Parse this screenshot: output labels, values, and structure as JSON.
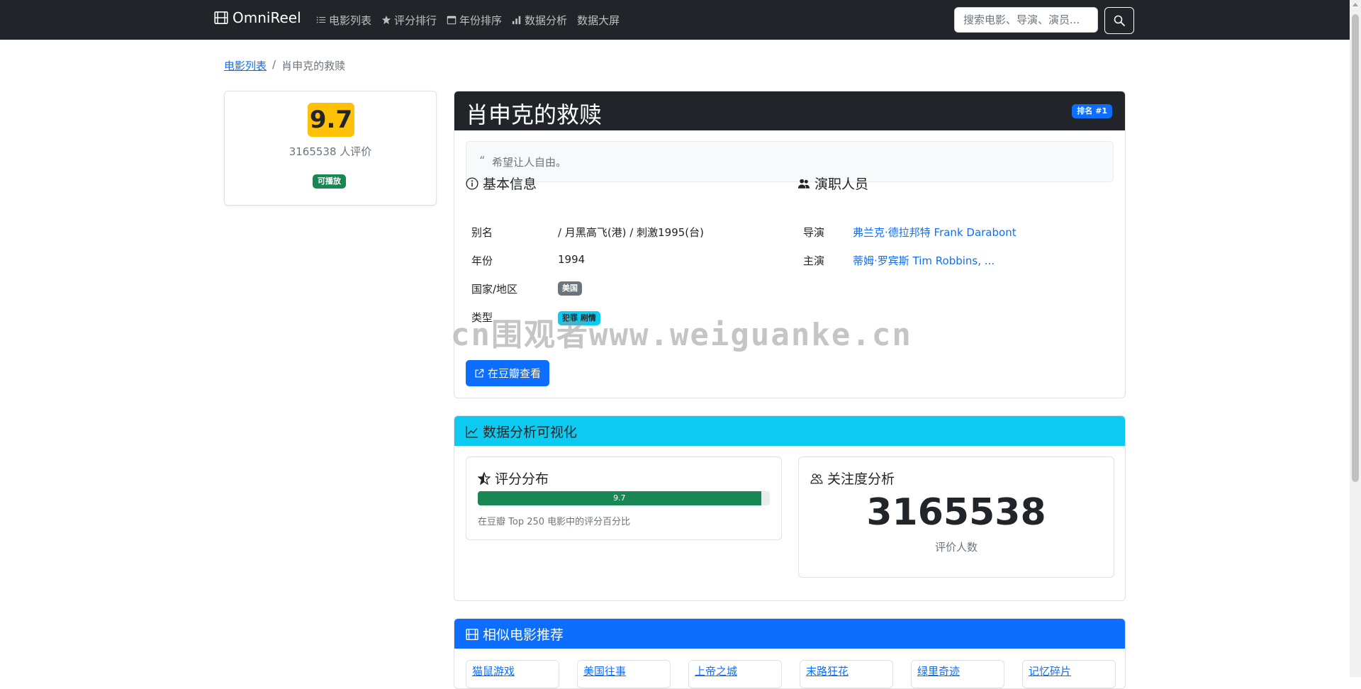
{
  "navbar": {
    "brand": "OmniReel",
    "links": [
      {
        "label": "电影列表",
        "icon": "list-icon"
      },
      {
        "label": "评分排行",
        "icon": "star-icon"
      },
      {
        "label": "年份排序",
        "icon": "calendar-icon"
      },
      {
        "label": "数据分析",
        "icon": "bar-chart-icon"
      },
      {
        "label": "数据大屏",
        "icon": ""
      }
    ],
    "search_placeholder": "搜索电影、导演、演员..."
  },
  "breadcrumb": {
    "parent": "电影列表",
    "separator": "/",
    "current": "肖申克的救赎"
  },
  "sidebar": {
    "score": "9.7",
    "rating_count": "3165538 人评价",
    "play_badge": "可播放"
  },
  "movie": {
    "title": "肖申克的救赎",
    "rank_badge": "排名 #1",
    "quote_mark": "“",
    "quote": "希望让人自由。",
    "basic_info_title": "基本信息",
    "labels": {
      "alias": "别名",
      "year": "年份",
      "country": "国家/地区",
      "genre": "类型"
    },
    "alias": "/ 月黑高飞(港) / 刺激1995(台)",
    "year": "1994",
    "country": "美国",
    "genre": "犯罪 剧情",
    "cast_title": "演职人员",
    "director_label": "导演",
    "director": "弗兰克·德拉邦特 Frank Darabont",
    "actors_label": "主演",
    "actors": "蒂姆·罗宾斯 Tim Robbins, ...",
    "douban_button": "在豆瓣查看"
  },
  "watermark": "cn围观者www.weiguanke.cn",
  "analysis": {
    "title": "数据分析可视化",
    "rating_dist": {
      "title": "评分分布",
      "value": 9.7,
      "bar_label": "9.7",
      "note": "在豆瓣 Top 250 电影中的评分百分比"
    },
    "attention": {
      "title": "关注度分析",
      "value": "3165538",
      "label": "评价人数"
    }
  },
  "similar": {
    "title": "相似电影推荐",
    "items": [
      "猫鼠游戏",
      "美国往事",
      "上帝之城",
      "末路狂花",
      "绿里奇迹",
      "记忆碎片"
    ]
  },
  "colors": {
    "navbar": "#212529",
    "primary": "#0d6efd",
    "info": "#0dcaf0",
    "warning": "#ffc107",
    "success": "#198754",
    "secondary": "#6c757d"
  }
}
